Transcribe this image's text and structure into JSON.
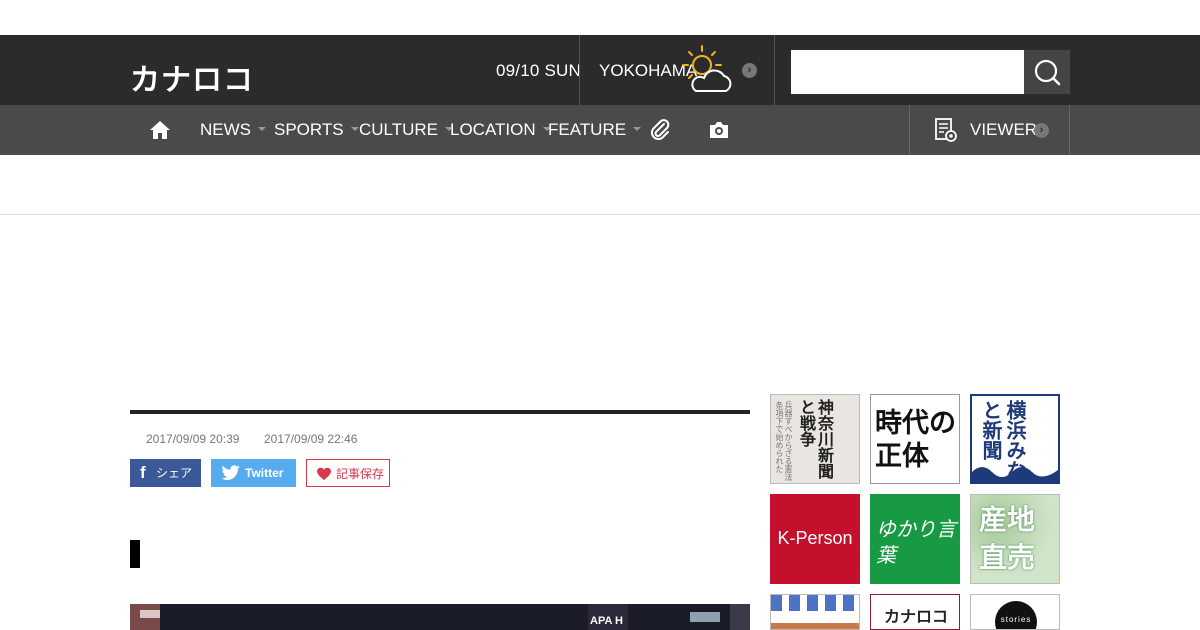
{
  "header": {
    "logo": "カナロコ",
    "date": "09/10 SUN",
    "city": "YOKOHAMA",
    "weather_icon": "sun-cloud-icon",
    "search": {
      "placeholder": ""
    }
  },
  "nav": {
    "home_icon": "home-icon",
    "items": [
      {
        "label": "NEWS"
      },
      {
        "label": "SPORTS"
      },
      {
        "label": "CULTURE"
      },
      {
        "label": "LOCATION"
      },
      {
        "label": "FEATURE"
      }
    ],
    "clip_icon": "paperclip-icon",
    "camera_icon": "camera-icon",
    "viewer_label": "VIEWER"
  },
  "article": {
    "published": "2017/09/09 20:39",
    "updated": "2017/09/09 22:46",
    "share": {
      "facebook": "シェア",
      "twitter": "Twitter",
      "save": "記事保存"
    },
    "photo_sign": "APA H"
  },
  "sidebar": {
    "banners": [
      {
        "text": "神奈川新聞と戦争"
      },
      {
        "text": "時代の正体"
      },
      {
        "text": "横浜みなと新聞"
      },
      {
        "text": "K-Person"
      },
      {
        "text": "ゆかり言葉"
      },
      {
        "text": "産地直売"
      },
      {
        "text": ""
      },
      {
        "text": "カナロコ"
      },
      {
        "text": "stories"
      }
    ]
  },
  "colors": {
    "header_bg": "#2b2b2b",
    "nav_bg": "#4a4a4a",
    "facebook": "#3b5998",
    "twitter": "#55acee",
    "save": "#d63a4c",
    "kperson": "#c4102c",
    "green": "#179a43",
    "minato": "#1e3a7a"
  }
}
